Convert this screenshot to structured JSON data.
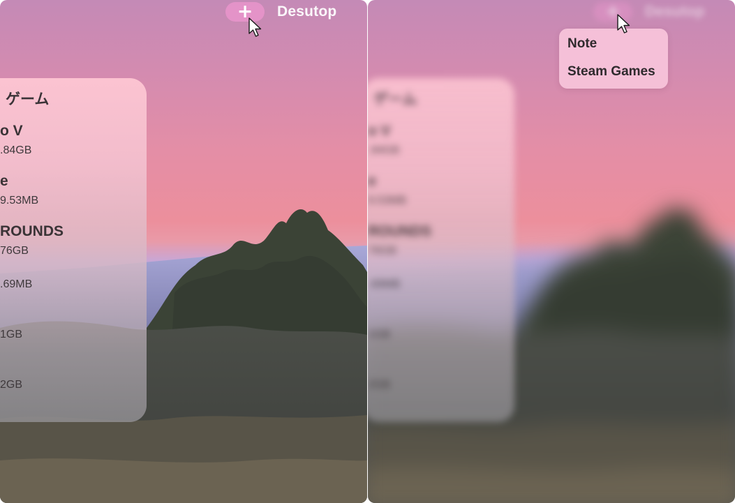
{
  "left_panel": {
    "topbar": {
      "add_label": "+",
      "title": "Desutop"
    },
    "card": {
      "title": "ゲーム",
      "games": [
        {
          "name": "o V",
          "size": ".84GB"
        },
        {
          "name": "e",
          "size": "9.53MB"
        },
        {
          "name": "ROUNDS",
          "size": "76GB"
        },
        {
          "name": "",
          "size": ".69MB"
        },
        {
          "name": "",
          "size": "1GB"
        },
        {
          "name": "",
          "size": "2GB"
        }
      ]
    }
  },
  "right_panel": {
    "topbar": {
      "add_label": "+",
      "title": "Desutop"
    },
    "card": {
      "title": "ゲーム",
      "games": [
        {
          "name": "o V",
          "size": ".84GB"
        },
        {
          "name": "e",
          "size": "9.53MB"
        },
        {
          "name": "ROUNDS",
          "size": "76GB"
        },
        {
          "name": "",
          "size": ".69MB"
        },
        {
          "name": "",
          "size": "1GB"
        },
        {
          "name": "",
          "size": "2GB"
        }
      ]
    },
    "dropdown": {
      "items": [
        "Note",
        "Steam Games"
      ]
    }
  },
  "icons": {
    "add": "plus-icon",
    "cursor": "mouse-pointer-icon"
  }
}
